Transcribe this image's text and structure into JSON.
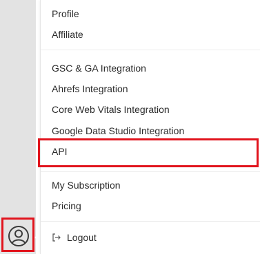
{
  "menu": {
    "groups": [
      {
        "items": [
          "Profile",
          "Affiliate"
        ]
      },
      {
        "items": [
          "GSC & GA Integration",
          "Ahrefs Integration",
          "Core Web Vitals Integration",
          "Google Data Studio Integration",
          "API"
        ]
      },
      {
        "items": [
          "My Subscription",
          "Pricing"
        ]
      }
    ],
    "profile": "Profile",
    "affiliate": "Affiliate",
    "gsc_ga": "GSC & GA Integration",
    "ahrefs": "Ahrefs Integration",
    "core_web_vitals": "Core Web Vitals Integration",
    "google_data_studio": "Google Data Studio Integration",
    "api": "API",
    "my_subscription": "My Subscription",
    "pricing": "Pricing",
    "logout": "Logout"
  },
  "icons": {
    "avatar": "user-circle-icon",
    "logout": "logout-icon"
  },
  "colors": {
    "highlight": "#e1141d",
    "rail": "#e3e3e3",
    "text": "#2b2b2b"
  }
}
